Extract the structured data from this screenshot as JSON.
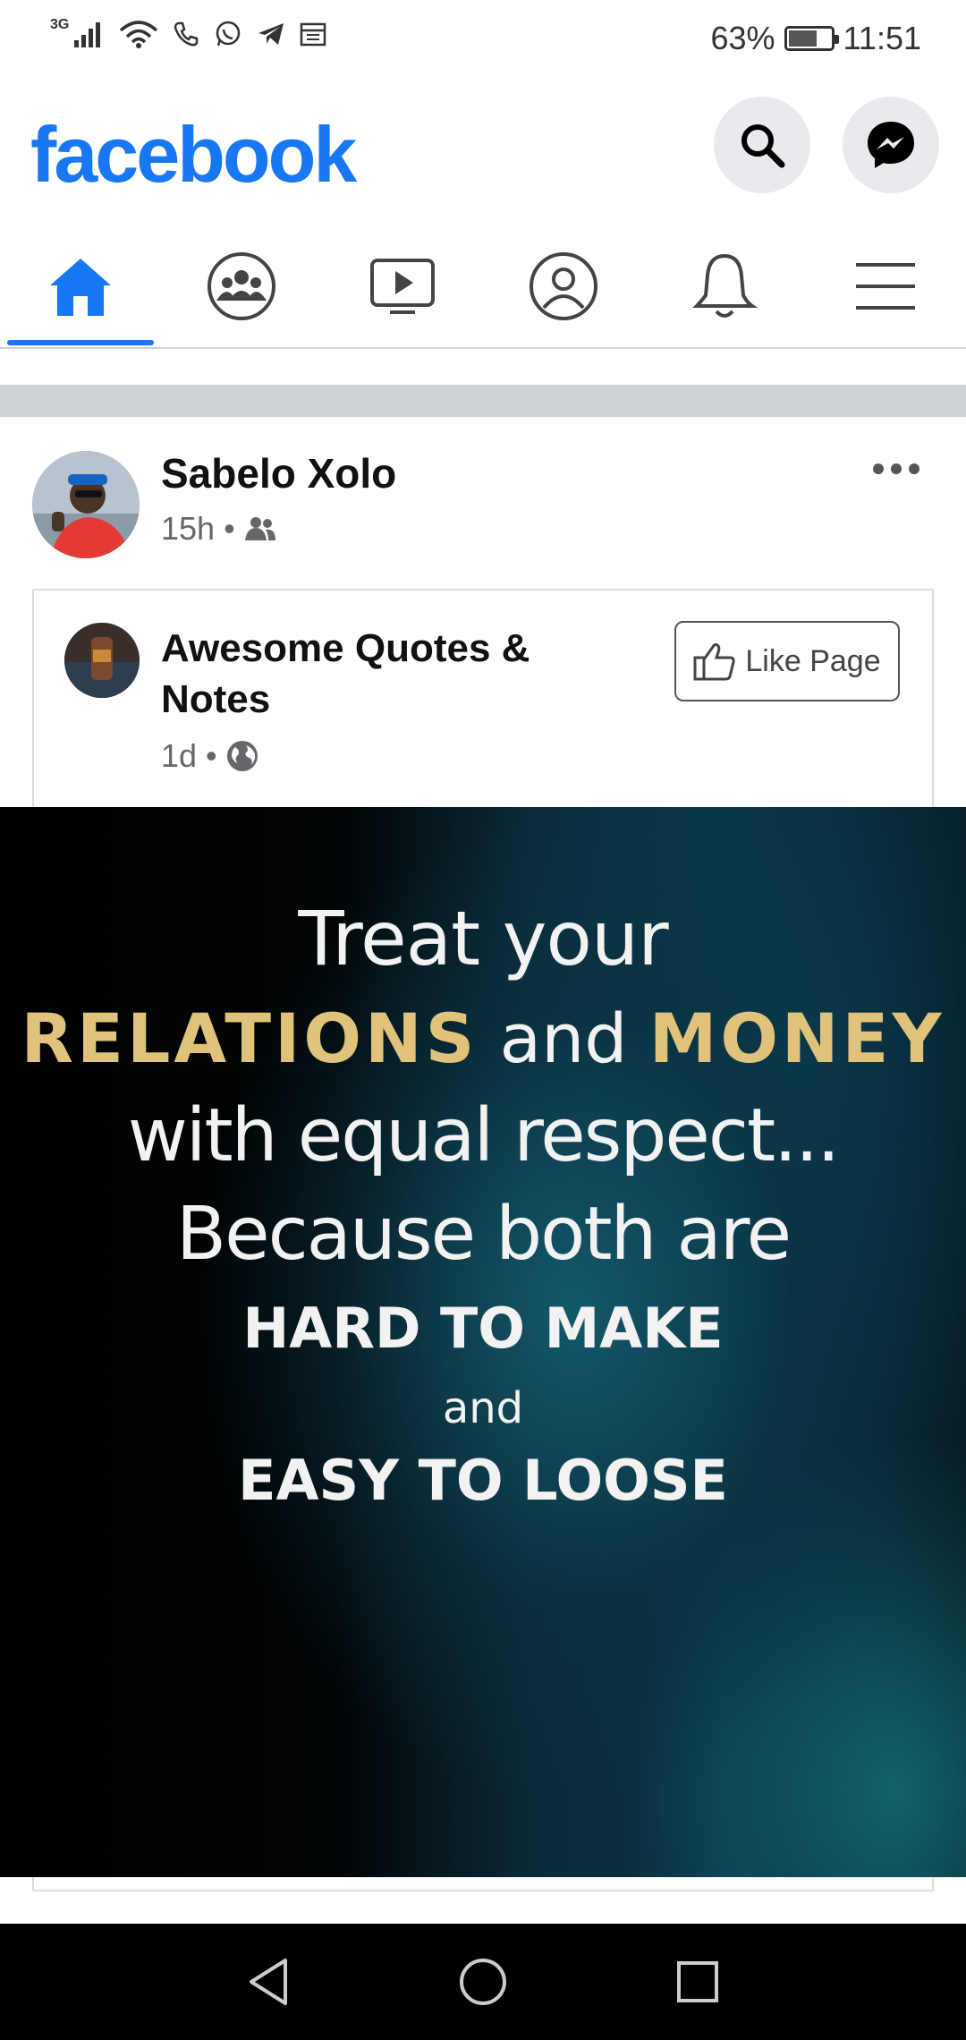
{
  "status_bar": {
    "network": "3G",
    "battery": "63%",
    "battery_level": 0.63,
    "time": "11:51"
  },
  "header": {
    "logo": "facebook",
    "search_icon": "search-icon",
    "messenger_icon": "messenger-icon"
  },
  "nav": {
    "active_tab": "home",
    "tabs": [
      "home",
      "groups",
      "watch",
      "profile",
      "notifications",
      "menu"
    ]
  },
  "post": {
    "author": "Sabelo Xolo",
    "time": "15h",
    "audience_icon": "friends-icon",
    "shared": {
      "page_name": "Awesome Quotes & Notes",
      "time": "1d",
      "audience_icon": "globe-icon",
      "like_page_label": "Like Page"
    },
    "image_text": {
      "line1": "Treat your",
      "line2_part1": "RELATIONS",
      "line2_part2": "and",
      "line2_part3": "MONEY",
      "line3": "with equal respect...",
      "line4": "Because both are",
      "line5": "HARD TO MAKE",
      "line6": "and",
      "line7": "EASY TO LOOSE"
    }
  },
  "colors": {
    "brand": "#1877f2",
    "gold": "#e0c27a"
  }
}
